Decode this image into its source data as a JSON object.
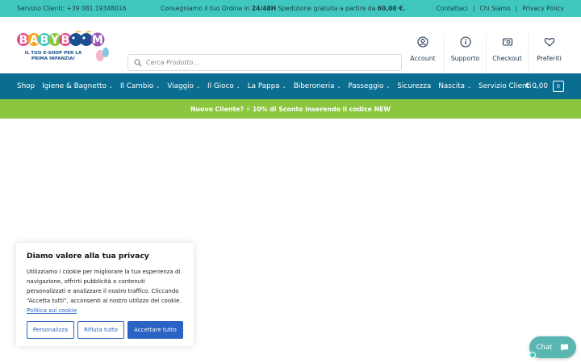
{
  "topbar": {
    "service_label": "Servizio Clienti: +39 081 19348016",
    "shipping_text_1": "Consegniamo il tuo Ordine in ",
    "shipping_bold_1": "24/48H",
    "shipping_text_2": " Spedizione gratuita a partire da ",
    "shipping_bold_2": "60,00 €.",
    "links": [
      "Contattaci",
      "Chi Siamo",
      "Privacy Policy"
    ],
    "separator": "|"
  },
  "header": {
    "logo_text": "BABYBOOM",
    "logo_tagline_1": "IL TUO E-SHOP PER LA",
    "logo_tagline_2": "PRIMA INFANZIA!",
    "search_placeholder": "Cerca Prodotto...",
    "icons": [
      {
        "label": "Account",
        "icon": "user-icon"
      },
      {
        "label": "Supporto",
        "icon": "info-icon"
      },
      {
        "label": "Checkout",
        "icon": "checkout-icon"
      },
      {
        "label": "Preferiti",
        "icon": "heart-icon"
      }
    ]
  },
  "nav": {
    "items": [
      {
        "label": "Shop",
        "dropdown": false
      },
      {
        "label": "Igiene & Bagnetto",
        "dropdown": true
      },
      {
        "label": "Il Cambio",
        "dropdown": true
      },
      {
        "label": "Viaggio",
        "dropdown": true
      },
      {
        "label": "Il Gioco",
        "dropdown": true
      },
      {
        "label": "La Pappa",
        "dropdown": true
      },
      {
        "label": "Biberoneria",
        "dropdown": true
      },
      {
        "label": "Passeggio",
        "dropdown": true
      },
      {
        "label": "Sicurezza",
        "dropdown": false
      },
      {
        "label": "Nascita",
        "dropdown": true
      },
      {
        "label": "Servizio Clienti",
        "dropdown": true
      }
    ],
    "cart_total": "€ 0,00",
    "cart_count": "0"
  },
  "promo": {
    "text": "Nuovo Cliente? ⚡ 10% di Sconto inserendo il codice NEW"
  },
  "cookie": {
    "title": "Diamo valore alla tua privacy",
    "body": "Utilizziamo i cookie per migliorare la tua esperienza di navigazione, offrirti pubblicità o contenuti personalizzati e analizzare il nostro traffico. Cliccando “Accetta tutti”, acconsenti al nostro utilizzo dei cookie. ",
    "policy_link": "Politica sui cookie",
    "buttons": {
      "customize": "Personalizza",
      "reject": "Rifiuta tutto",
      "accept": "Accettare tutto"
    }
  },
  "chat": {
    "label": "Chat"
  },
  "colors": {
    "topbar": "#40c8c0",
    "nav": "#0b6e91",
    "promo": "#8cc63f",
    "accent_blue": "#2b63c4"
  }
}
